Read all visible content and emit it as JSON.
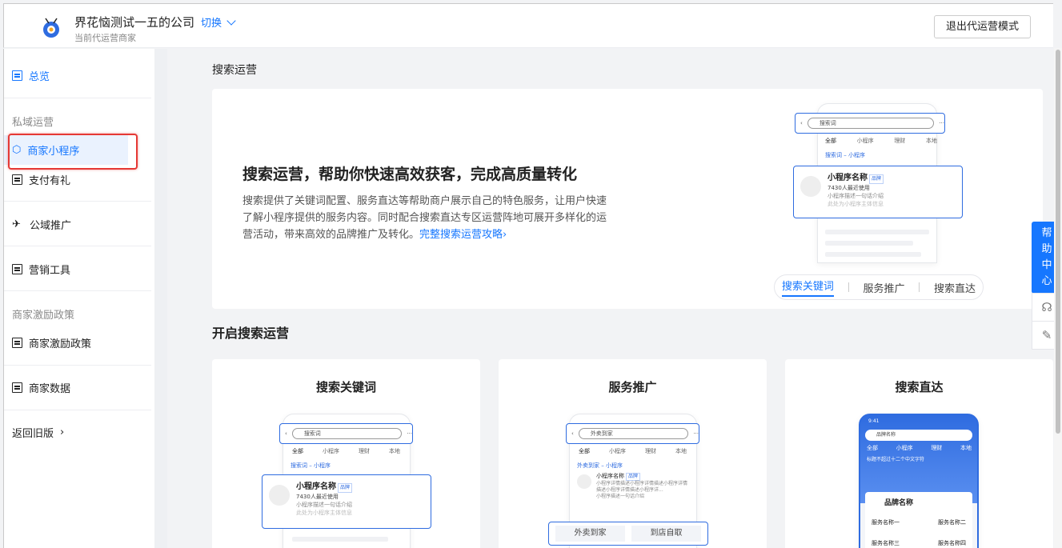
{
  "header": {
    "company_name": "界花恼测试一五的公司",
    "switch_label": "切换",
    "subtitle": "当前代运营商家",
    "exit_button": "退出代运营模式"
  },
  "sidebar": {
    "overview": "总览",
    "group_private": "私域运营",
    "mini_program": "商家小程序",
    "pay_gift": "支付有礼",
    "public_promo": "公域推广",
    "marketing_tools": "营销工具",
    "group_incentive": "商家激励政策",
    "incentive_policy": "商家激励政策",
    "merchant_data": "商家数据",
    "back_old": "返回旧版"
  },
  "main": {
    "page_title": "搜索运营",
    "hero": {
      "title": "搜索运营，帮助你快速高效获客，完成高质量转化",
      "desc": "搜索提供了关键词配置、服务直达等帮助商户展示自己的特色服务，让用户快速了解小程序提供的服务内容。同时配合搜索直达专区运营阵地可展开多样化的运营活动，带来高效的品牌推广及转化。",
      "link": "完整搜索运营攻略",
      "tabs": [
        "搜索关键词",
        "服务推广",
        "搜索直达"
      ]
    },
    "section_title": "开启搜索运营",
    "cards": [
      "搜索关键词",
      "服务推广",
      "搜索直达"
    ]
  },
  "mock": {
    "search_keyword": "搜索词",
    "tabs": [
      "全部",
      "小程序",
      "理财",
      "本地"
    ],
    "keyword_line": "搜索词 – 小程序",
    "more": "全部 >",
    "mp_name": "小程序名称",
    "brand_tag": "品牌",
    "used": "7430人最近使用",
    "intro": "小程序描述一句话介绍",
    "entity": "此处为小程序主体信息",
    "service_keyword": "外卖到家",
    "service_line": "外卖到家 – 小程序",
    "service_btn1": "外卖到家",
    "service_btn2": "到店自取",
    "service_desc": "小程序详情描述小程序详情描述小程序详情描述小程序详情描述小程序详...",
    "direct_keyword": "品牌名称",
    "direct_time": "9:41",
    "direct_banner": "标题不超过十二个中文字符",
    "direct_brand": "品牌名称",
    "direct_services": [
      "服务名称一",
      "服务名称二",
      "服务名称三",
      "服务名称四"
    ]
  },
  "float": {
    "help": "帮助中心"
  },
  "colors": {
    "accent": "#1677ff",
    "highlight": "#e53935"
  }
}
